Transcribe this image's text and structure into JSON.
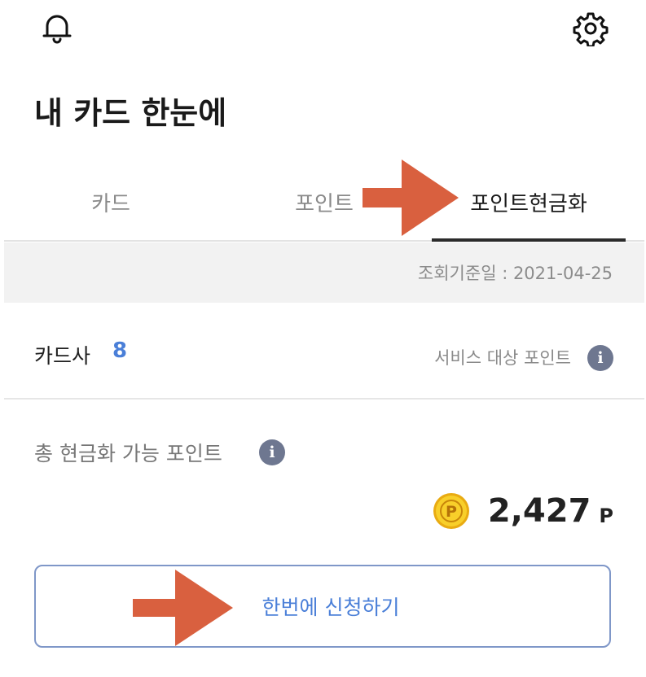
{
  "header": {
    "bell_icon": "bell-icon",
    "settings_icon": "gear-icon"
  },
  "page": {
    "title": "내 카드 한눈에"
  },
  "tabs": [
    {
      "label": "카드",
      "selected": false
    },
    {
      "label": "포인트",
      "selected": false
    },
    {
      "label": "포인트현금화",
      "selected": true
    }
  ],
  "query": {
    "date_label": "조회기준일 : 2021-04-25"
  },
  "card_summary": {
    "label": "카드사",
    "count": "8",
    "service_label": "서비스 대상 포인트",
    "info_glyph": "i"
  },
  "points": {
    "total_label": "총 현금화 가능 포인트",
    "info_glyph": "i",
    "coin_letter": "P",
    "amount": "2,427",
    "unit": "P"
  },
  "actions": {
    "apply_label": "한번에 신청하기"
  },
  "colors": {
    "accent_blue": "#4a7fd8",
    "annotation_arrow": "#d9603f",
    "coin_gold": "#f5c21b"
  }
}
